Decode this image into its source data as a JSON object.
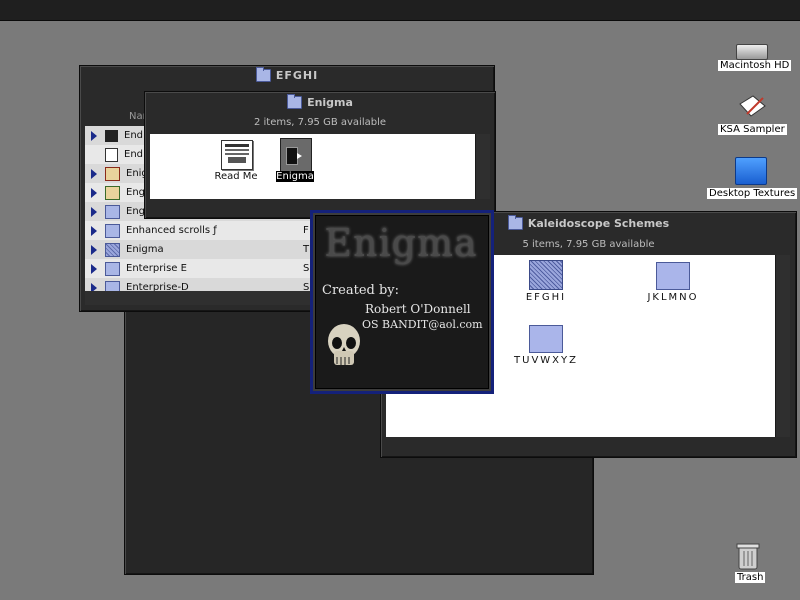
{
  "desktop": {
    "icons": [
      {
        "label": "Macintosh HD"
      },
      {
        "label": "KSA Sampler"
      },
      {
        "label": "Desktop Textures"
      },
      {
        "label": "Trash"
      }
    ]
  },
  "windows": {
    "efghi": {
      "title": "EFGHI",
      "column_header": "Nar",
      "rows": [
        {
          "name": "End",
          "kind": ""
        },
        {
          "name": "End",
          "kind": ""
        },
        {
          "name": "Enig",
          "kind": ""
        },
        {
          "name": "Eng",
          "kind": ""
        },
        {
          "name": "Eng",
          "kind": ""
        },
        {
          "name": "Enhanced scrolls ƒ",
          "kind": "F"
        },
        {
          "name": "Enigma",
          "kind": "T"
        },
        {
          "name": "Enterprise E",
          "kind": "S"
        },
        {
          "name": "Enterprise-D",
          "kind": "S"
        }
      ]
    },
    "enigma": {
      "title": "Enigma",
      "info": "2 items, 7.95 GB available",
      "items": [
        {
          "label": "Read Me"
        },
        {
          "label": "Enigma"
        }
      ]
    },
    "kaleidoscope": {
      "title": "Kaleidoscope Schemes",
      "info": "5 items, 7.95 GB available",
      "items": [
        {
          "label": "EFGHI"
        },
        {
          "label": "JKLMNO"
        },
        {
          "label": "TUVWXYZ"
        }
      ]
    }
  },
  "about": {
    "logo_text": "Enigma",
    "created_by": "Created by:",
    "author": "Robert O'Donnell",
    "email": "OS BANDIT@aol.com"
  }
}
